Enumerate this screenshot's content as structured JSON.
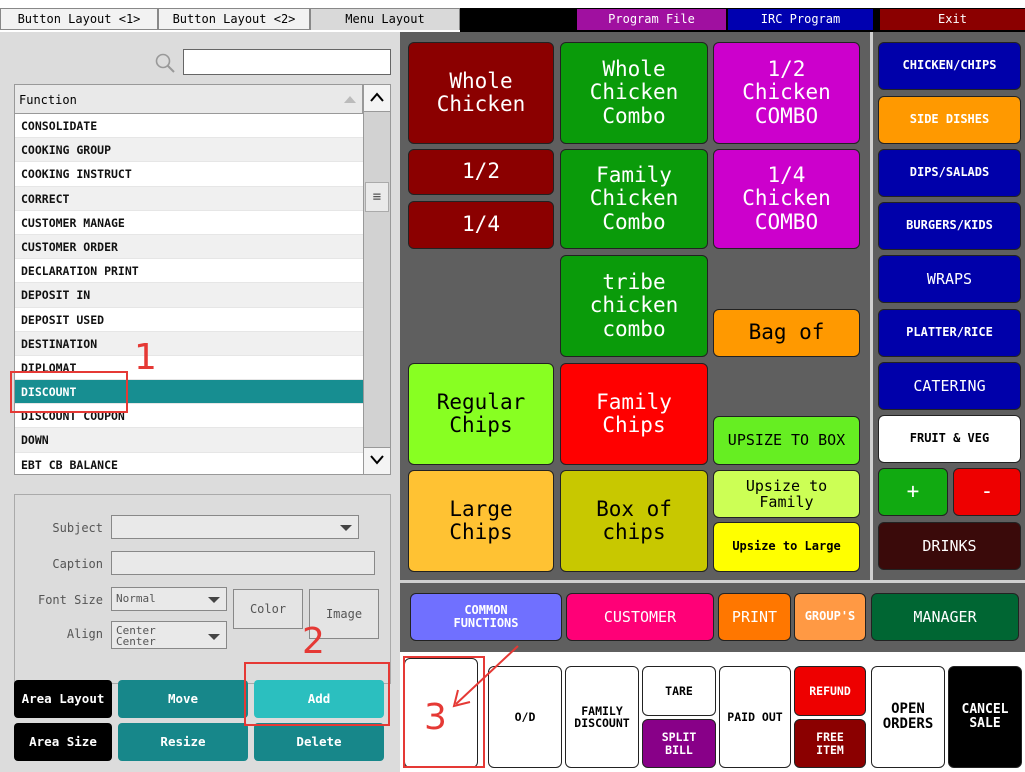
{
  "tabs": {
    "layout1": "Button Layout <1>",
    "layout2": "Button Layout <2>",
    "menu_layout": "Menu Layout"
  },
  "top_buttons": {
    "program_file": "Program File",
    "irc_program": "IRC Program",
    "exit": "Exit"
  },
  "function_list": {
    "header": "Function",
    "items": [
      "CONSOLIDATE",
      "COOKING GROUP",
      "COOKING INSTRUCT",
      "CORRECT",
      "CUSTOMER MANAGE",
      "CUSTOMER ORDER",
      "DECLARATION PRINT",
      "DEPOSIT IN",
      "DEPOSIT USED",
      "DESTINATION",
      "DIPLOMAT",
      "DISCOUNT",
      "DISCOUNT COUPON",
      "DOWN",
      "EBT CB BALANCE"
    ],
    "selected": "DISCOUNT"
  },
  "properties": {
    "subject_label": "Subject",
    "caption_label": "Caption",
    "font_size_label": "Font Size",
    "font_size_value": "Normal",
    "align_label": "Align",
    "align_value_1": "Center",
    "align_value_2": "Center",
    "color_button": "Color",
    "image_button": "Image"
  },
  "area_buttons": {
    "area_layout": "Area Layout",
    "move": "Move",
    "add": "Add",
    "area_size": "Area Size",
    "resize": "Resize",
    "delete": "Delete"
  },
  "menu_keys": {
    "whole_chicken": "Whole\nChicken",
    "whole_chicken_combo": "Whole\nChicken\nCombo",
    "half_chicken_combo": "1/2\nChicken\nCOMBO",
    "half": "1/2",
    "quarter": "1/4",
    "family_chicken_combo": "Family\nChicken\nCombo",
    "quarter_chicken_combo": "1/4\nChicken\nCOMBO",
    "tribe_chicken_combo": "tribe\nchicken\ncombo",
    "bag_of": "Bag of",
    "regular_chips": "Regular\nChips",
    "family_chips": "Family\nChips",
    "upsize_to_box": "UPSIZE TO BOX",
    "large_chips": "Large\nChips",
    "box_of_chips": "Box of\nchips",
    "upsize_to_family": "Upsize to\nFamily",
    "upsize_to_large": "Upsize to Large"
  },
  "categories": {
    "chicken_chips": "CHICKEN/CHIPS",
    "side_dishes": "SIDE DISHES",
    "dips_salads": "DIPS/SALADS",
    "burgers_kids": "BURGERS/KIDS",
    "wraps": "WRAPS",
    "platter_rice": "PLATTER/RICE",
    "catering": "CATERING",
    "fruit_veg": "FRUIT & VEG",
    "plus": "+",
    "minus": "-",
    "drinks": "DRINKS"
  },
  "strip_buttons": {
    "common_functions": "COMMON\nFUNCTIONS",
    "customer": "CUSTOMER",
    "print": "PRINT",
    "groups": "GROUP'S",
    "manager": "MANAGER"
  },
  "function_keys": {
    "od": "O/D",
    "family_discount": "FAMILY\nDISCOUNT",
    "tare": "TARE",
    "split_bill": "SPLIT\nBILL",
    "paid_out": "PAID OUT",
    "refund": "REFUND",
    "free_item": "FREE\nITEM",
    "open_orders": "OPEN\nORDERS",
    "cancel_sale": "CANCEL\nSALE"
  },
  "annotations": {
    "one": "1",
    "two": "2",
    "three": "3"
  },
  "colors": {
    "dark_red": "#8b0000",
    "green": "#0a9b0a",
    "magenta": "#cc00cc",
    "orange": "#ff9900",
    "lime": "#88ff22",
    "red": "#ff0000",
    "olive": "#c8c800",
    "yellow": "#ffff00",
    "navy": "#0000aa",
    "teal": "#17878a",
    "annotation_red": "#e53935"
  }
}
